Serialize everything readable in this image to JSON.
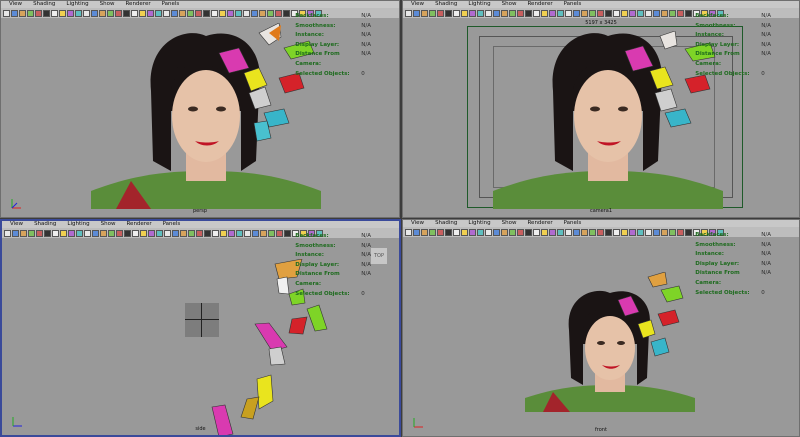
{
  "menu": [
    "View",
    "Shading",
    "Lighting",
    "Show",
    "Renderer",
    "Panels"
  ],
  "hud": [
    {
      "label": "Backfaces:",
      "value": "N/A"
    },
    {
      "label": "Smoothness:",
      "value": "N/A"
    },
    {
      "label": "Instance:",
      "value": "N/A"
    },
    {
      "label": "Display Layer:",
      "value": "N/A"
    },
    {
      "label": "Distance From Camera:",
      "value": "N/A"
    },
    {
      "label": "Selected Objects:",
      "value": "0"
    }
  ],
  "panes": {
    "persp": {
      "camera": "persp"
    },
    "camera1": {
      "camera": "camera1",
      "resolution": "5197 x 3425"
    },
    "side": {
      "camera": "side",
      "view_cube": "TOP"
    },
    "front": {
      "camera": "front"
    }
  },
  "colors": {
    "viewport": "#999999",
    "active_border": "#3a4a9a",
    "hud_label": "#1e6b1e",
    "gate": "#1f5a2a"
  },
  "icons": [
    "select-icon",
    "move-icon",
    "rotate-icon",
    "scale-icon",
    "render-icon",
    "camera-icon",
    "grid-icon",
    "light-icon",
    "texture-icon",
    "shaded-icon"
  ]
}
